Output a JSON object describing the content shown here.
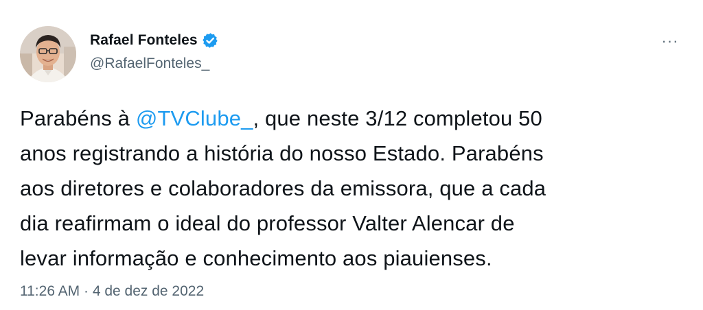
{
  "author": {
    "display_name": "Rafael Fonteles",
    "handle": "@RafaelFonteles_",
    "verified": true,
    "avatar_icon": "profile-photo"
  },
  "menu": {
    "more_label": "···"
  },
  "tweet": {
    "lines": [
      {
        "before": "Parabéns à ",
        "mention": "@TVClube_",
        "after": ", que neste 3/12 completou 50"
      },
      {
        "text": "anos registrando a história do nosso Estado. Parabéns"
      },
      {
        "text": "aos diretores e colaboradores da emissora, que a cada"
      },
      {
        "text": "dia reafirmam o ideal do professor Valter Alencar de"
      },
      {
        "text": "levar informação e conhecimento aos piauienses."
      }
    ]
  },
  "meta": {
    "time": "11:26 AM",
    "separator": " · ",
    "date": "4 de dez de 2022"
  },
  "colors": {
    "text": "#0f1419",
    "secondary": "#536471",
    "link": "#1d9bf0",
    "verified": "#1d9bf0"
  }
}
